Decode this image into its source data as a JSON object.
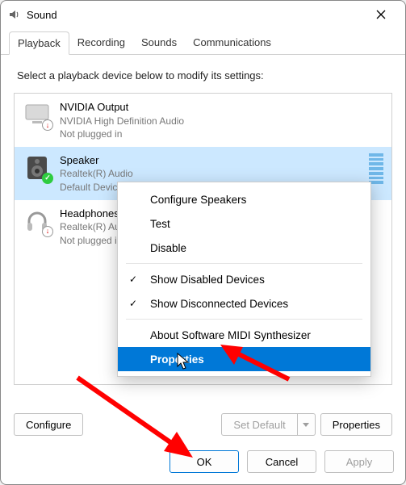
{
  "window": {
    "title": "Sound"
  },
  "tabs": {
    "playback": "Playback",
    "recording": "Recording",
    "sounds": "Sounds",
    "communications": "Communications",
    "active": "playback"
  },
  "instruction": "Select a playback device below to modify its settings:",
  "devices": [
    {
      "name": "NVIDIA Output",
      "driver": "NVIDIA High Definition Audio",
      "status": "Not plugged in",
      "icon": "monitor",
      "badge": "down",
      "selected": false
    },
    {
      "name": "Speaker",
      "driver": "Realtek(R) Audio",
      "status": "Default Device",
      "icon": "speaker",
      "badge": "ok",
      "selected": true
    },
    {
      "name": "Headphones",
      "driver": "Realtek(R) Audio",
      "status": "Not plugged in",
      "icon": "headphones",
      "badge": "down",
      "selected": false
    }
  ],
  "context_menu": {
    "items": {
      "configure": "Configure Speakers",
      "test": "Test",
      "disable": "Disable",
      "show_disabled": "Show Disabled Devices",
      "show_disconnected": "Show Disconnected Devices",
      "about_midi": "About Software MIDI Synthesizer",
      "properties": "Properties"
    },
    "checked": [
      "show_disabled",
      "show_disconnected"
    ],
    "highlighted": "properties"
  },
  "buttons": {
    "configure": "Configure",
    "set_default": "Set Default",
    "properties": "Properties",
    "ok": "OK",
    "cancel": "Cancel",
    "apply": "Apply"
  },
  "annotation_arrows": true
}
